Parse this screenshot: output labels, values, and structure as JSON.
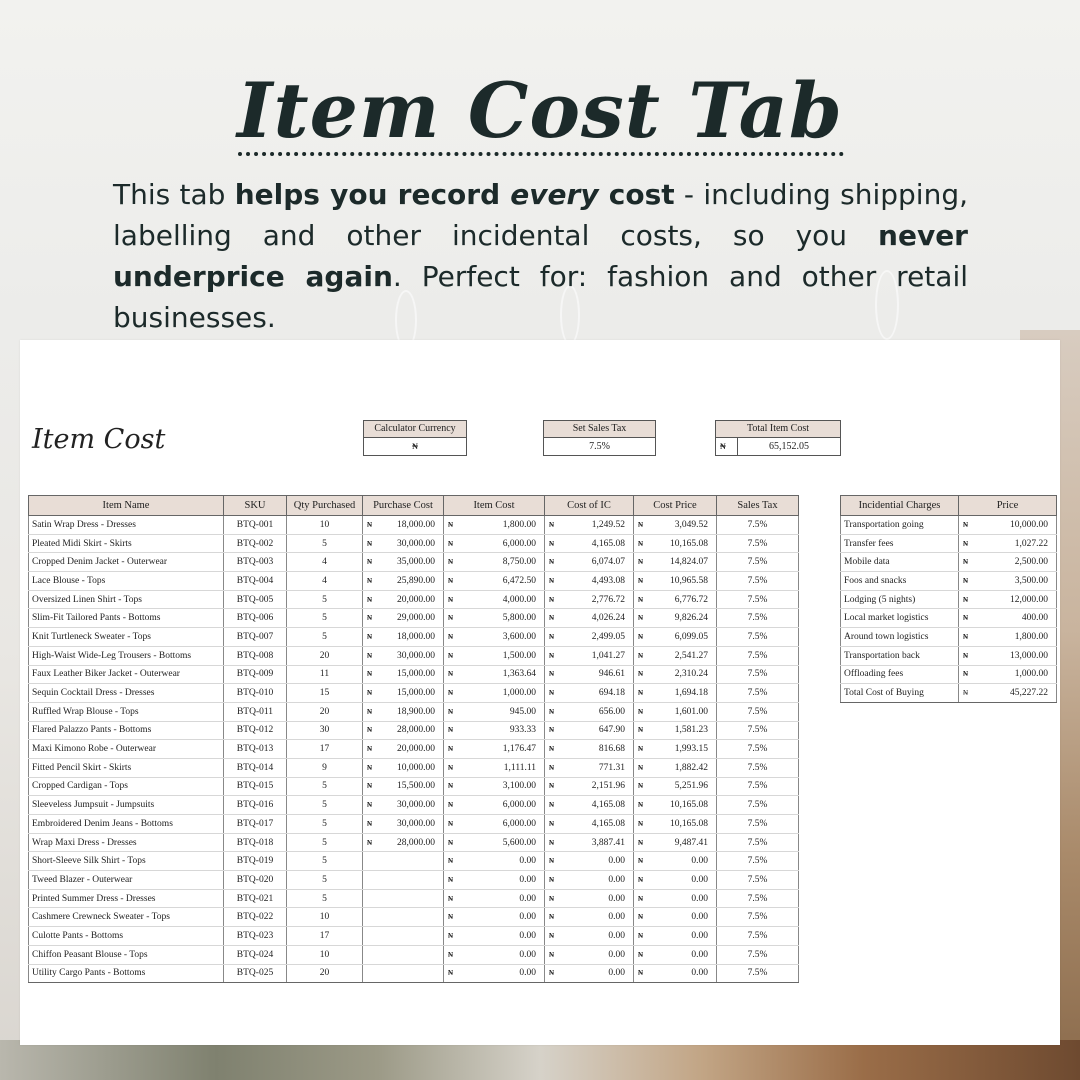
{
  "headline": "Item Cost Tab",
  "description": {
    "p1": "This tab ",
    "b1": "helps you record ",
    "i1": "every",
    "b2": " cost",
    "p2": " - including shipping, labelling and other incidental costs, so you ",
    "b3": "never underprice again",
    "p3": ". Perfect for: fashion and other retail businesses."
  },
  "sheet": {
    "title": "Item Cost",
    "calculator_currency": {
      "label": "Calculator Currency",
      "value": "₦"
    },
    "set_sales_tax": {
      "label": "Set Sales Tax",
      "value": "7.5%"
    },
    "total_item_cost": {
      "label": "Total Item Cost",
      "currency": "₦",
      "value": "65,152.05"
    },
    "columns": [
      "Item Name",
      "SKU",
      "Qty Purchased",
      "Purchase Cost",
      "Item Cost",
      "Cost of IC",
      "Cost Price",
      "Sales Tax"
    ],
    "currency_symbol": "₦",
    "rows": [
      {
        "name": "Satin Wrap Dress - Dresses",
        "sku": "BTQ-001",
        "qty": "10",
        "purchase": "18,000.00",
        "item": "1,800.00",
        "ic": "1,249.52",
        "price": "3,049.52",
        "tax": "7.5%"
      },
      {
        "name": "Pleated Midi Skirt - Skirts",
        "sku": "BTQ-002",
        "qty": "5",
        "purchase": "30,000.00",
        "item": "6,000.00",
        "ic": "4,165.08",
        "price": "10,165.08",
        "tax": "7.5%"
      },
      {
        "name": "Cropped Denim Jacket - Outerwear",
        "sku": "BTQ-003",
        "qty": "4",
        "purchase": "35,000.00",
        "item": "8,750.00",
        "ic": "6,074.07",
        "price": "14,824.07",
        "tax": "7.5%"
      },
      {
        "name": "Lace Blouse - Tops",
        "sku": "BTQ-004",
        "qty": "4",
        "purchase": "25,890.00",
        "item": "6,472.50",
        "ic": "4,493.08",
        "price": "10,965.58",
        "tax": "7.5%"
      },
      {
        "name": "Oversized Linen Shirt - Tops",
        "sku": "BTQ-005",
        "qty": "5",
        "purchase": "20,000.00",
        "item": "4,000.00",
        "ic": "2,776.72",
        "price": "6,776.72",
        "tax": "7.5%"
      },
      {
        "name": "Slim-Fit Tailored Pants - Bottoms",
        "sku": "BTQ-006",
        "qty": "5",
        "purchase": "29,000.00",
        "item": "5,800.00",
        "ic": "4,026.24",
        "price": "9,826.24",
        "tax": "7.5%"
      },
      {
        "name": "Knit Turtleneck Sweater - Tops",
        "sku": "BTQ-007",
        "qty": "5",
        "purchase": "18,000.00",
        "item": "3,600.00",
        "ic": "2,499.05",
        "price": "6,099.05",
        "tax": "7.5%"
      },
      {
        "name": "High-Waist Wide-Leg Trousers - Bottoms",
        "sku": "BTQ-008",
        "qty": "20",
        "purchase": "30,000.00",
        "item": "1,500.00",
        "ic": "1,041.27",
        "price": "2,541.27",
        "tax": "7.5%"
      },
      {
        "name": "Faux Leather Biker Jacket - Outerwear",
        "sku": "BTQ-009",
        "qty": "11",
        "purchase": "15,000.00",
        "item": "1,363.64",
        "ic": "946.61",
        "price": "2,310.24",
        "tax": "7.5%"
      },
      {
        "name": "Sequin Cocktail Dress - Dresses",
        "sku": "BTQ-010",
        "qty": "15",
        "purchase": "15,000.00",
        "item": "1,000.00",
        "ic": "694.18",
        "price": "1,694.18",
        "tax": "7.5%"
      },
      {
        "name": "Ruffled Wrap Blouse - Tops",
        "sku": "BTQ-011",
        "qty": "20",
        "purchase": "18,900.00",
        "item": "945.00",
        "ic": "656.00",
        "price": "1,601.00",
        "tax": "7.5%"
      },
      {
        "name": "Flared Palazzo Pants - Bottoms",
        "sku": "BTQ-012",
        "qty": "30",
        "purchase": "28,000.00",
        "item": "933.33",
        "ic": "647.90",
        "price": "1,581.23",
        "tax": "7.5%"
      },
      {
        "name": "Maxi Kimono Robe - Outerwear",
        "sku": "BTQ-013",
        "qty": "17",
        "purchase": "20,000.00",
        "item": "1,176.47",
        "ic": "816.68",
        "price": "1,993.15",
        "tax": "7.5%"
      },
      {
        "name": "Fitted Pencil Skirt - Skirts",
        "sku": "BTQ-014",
        "qty": "9",
        "purchase": "10,000.00",
        "item": "1,111.11",
        "ic": "771.31",
        "price": "1,882.42",
        "tax": "7.5%"
      },
      {
        "name": "Cropped Cardigan - Tops",
        "sku": "BTQ-015",
        "qty": "5",
        "purchase": "15,500.00",
        "item": "3,100.00",
        "ic": "2,151.96",
        "price": "5,251.96",
        "tax": "7.5%"
      },
      {
        "name": "Sleeveless Jumpsuit - Jumpsuits",
        "sku": "BTQ-016",
        "qty": "5",
        "purchase": "30,000.00",
        "item": "6,000.00",
        "ic": "4,165.08",
        "price": "10,165.08",
        "tax": "7.5%"
      },
      {
        "name": "Embroidered Denim Jeans - Bottoms",
        "sku": "BTQ-017",
        "qty": "5",
        "purchase": "30,000.00",
        "item": "6,000.00",
        "ic": "4,165.08",
        "price": "10,165.08",
        "tax": "7.5%"
      },
      {
        "name": "Wrap Maxi Dress - Dresses",
        "sku": "BTQ-018",
        "qty": "5",
        "purchase": "28,000.00",
        "item": "5,600.00",
        "ic": "3,887.41",
        "price": "9,487.41",
        "tax": "7.5%"
      },
      {
        "name": "Short-Sleeve Silk Shirt - Tops",
        "sku": "BTQ-019",
        "qty": "5",
        "purchase": "",
        "item": "0.00",
        "ic": "0.00",
        "price": "0.00",
        "tax": "7.5%"
      },
      {
        "name": "Tweed Blazer - Outerwear",
        "sku": "BTQ-020",
        "qty": "5",
        "purchase": "",
        "item": "0.00",
        "ic": "0.00",
        "price": "0.00",
        "tax": "7.5%"
      },
      {
        "name": "Printed Summer Dress - Dresses",
        "sku": "BTQ-021",
        "qty": "5",
        "purchase": "",
        "item": "0.00",
        "ic": "0.00",
        "price": "0.00",
        "tax": "7.5%"
      },
      {
        "name": "Cashmere Crewneck Sweater - Tops",
        "sku": "BTQ-022",
        "qty": "10",
        "purchase": "",
        "item": "0.00",
        "ic": "0.00",
        "price": "0.00",
        "tax": "7.5%"
      },
      {
        "name": "Culotte Pants - Bottoms",
        "sku": "BTQ-023",
        "qty": "17",
        "purchase": "",
        "item": "0.00",
        "ic": "0.00",
        "price": "0.00",
        "tax": "7.5%"
      },
      {
        "name": "Chiffon Peasant Blouse - Tops",
        "sku": "BTQ-024",
        "qty": "10",
        "purchase": "",
        "item": "0.00",
        "ic": "0.00",
        "price": "0.00",
        "tax": "7.5%"
      },
      {
        "name": "Utility Cargo Pants - Bottoms",
        "sku": "BTQ-025",
        "qty": "20",
        "purchase": "",
        "item": "0.00",
        "ic": "0.00",
        "price": "0.00",
        "tax": "7.5%"
      }
    ],
    "incidental": {
      "columns": [
        "Incidential Charges",
        "Price"
      ],
      "rows": [
        {
          "label": "Transportation going",
          "value": "10,000.00"
        },
        {
          "label": "Transfer fees",
          "value": "1,027.22"
        },
        {
          "label": "Mobile data",
          "value": "2,500.00"
        },
        {
          "label": "Foos and snacks",
          "value": "3,500.00"
        },
        {
          "label": "Lodging (5 nights)",
          "value": "12,000.00"
        },
        {
          "label": "Local market logistics",
          "value": "400.00"
        },
        {
          "label": "Around town logistics",
          "value": "1,800.00"
        },
        {
          "label": "Transportation back",
          "value": "13,000.00"
        },
        {
          "label": "Offloading fees",
          "value": "1,000.00"
        }
      ],
      "total": {
        "label": "Total Cost of Buying",
        "value": "45,227.22"
      }
    }
  }
}
